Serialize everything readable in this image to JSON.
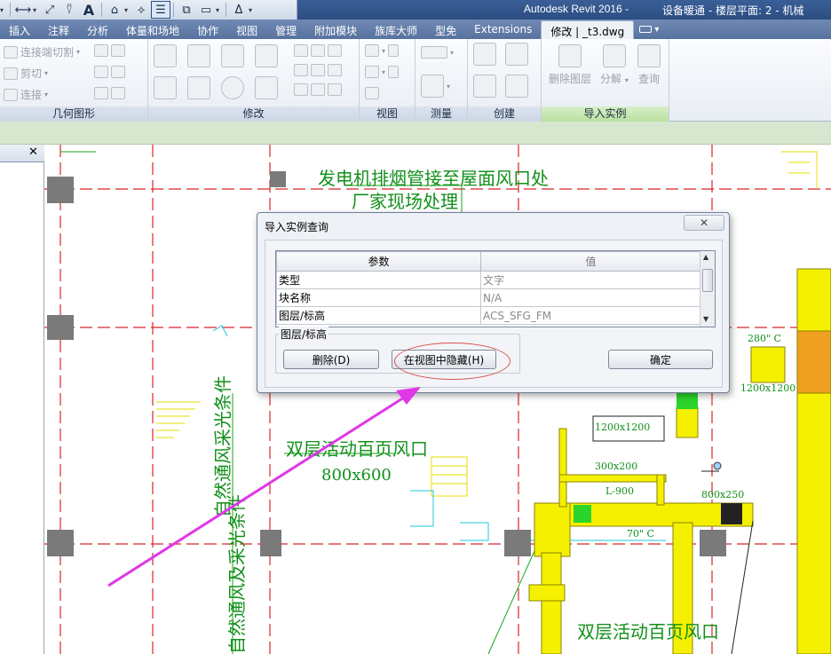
{
  "app": {
    "title": "Autodesk Revit 2016 -",
    "view_title": "设备暖通 - 楼层平面: 2 - 机械"
  },
  "quick_access": {
    "icons": [
      "open-icon",
      "measure-icon",
      "dimension-icon",
      "text-icon",
      "3d-view-icon",
      "tag-icon",
      "thin-lines-icon",
      "switch-windows-icon",
      "close-hidden-icon"
    ],
    "text_glyph": "A"
  },
  "tabs": [
    {
      "label": "插入"
    },
    {
      "label": "注释"
    },
    {
      "label": "分析"
    },
    {
      "label": "体量和场地"
    },
    {
      "label": "协作"
    },
    {
      "label": "视图"
    },
    {
      "label": "管理"
    },
    {
      "label": "附加模块"
    },
    {
      "label": "族库大师"
    },
    {
      "label": "型免"
    },
    {
      "label": "Extensions"
    },
    {
      "label": "修改 | _t3.dwg"
    }
  ],
  "ribbon": {
    "geometry": {
      "label": "几何图形",
      "items": [
        "连接端切割",
        "剪切",
        "连接"
      ]
    },
    "modify": {
      "label": "修改"
    },
    "view": {
      "label": "视图"
    },
    "measure": {
      "label": "测量"
    },
    "create": {
      "label": "创建"
    },
    "import_instance": {
      "label": "导入实例",
      "items": [
        "删除图层",
        "分解",
        "查询"
      ]
    }
  },
  "drawing": {
    "texts": [
      "发电机排烟管接至屋面风口处",
      "厂家现场处理",
      "双层活动百页风口",
      "800x600",
      "1200x1200",
      "300x200",
      "L-900",
      "800x250",
      "70\" C",
      "280\" C",
      "1200x1200",
      "70\" C",
      "300x200",
      "双层活动百页风口"
    ]
  },
  "dialog": {
    "title": "导入实例查询",
    "close": "✕",
    "table": {
      "headers": [
        "参数",
        "值"
      ],
      "rows": [
        [
          "类型",
          "文字"
        ],
        [
          "块名称",
          "N/A"
        ],
        [
          "图层/标高",
          "ACS_SFG_FM"
        ]
      ]
    },
    "group_label": "图层/标高",
    "buttons": {
      "delete": "删除(D)",
      "hide": "在视图中隐藏(H)",
      "ok": "确定"
    }
  },
  "colors": {
    "grid": "#d9252a",
    "cad_green": "#1aa51a",
    "duct_yellow": "#f5f000",
    "annotation_arrow": "#e037e8",
    "ribbon_tab_bg": "#5f7aa8",
    "options_bar": "#d7e6cf"
  }
}
